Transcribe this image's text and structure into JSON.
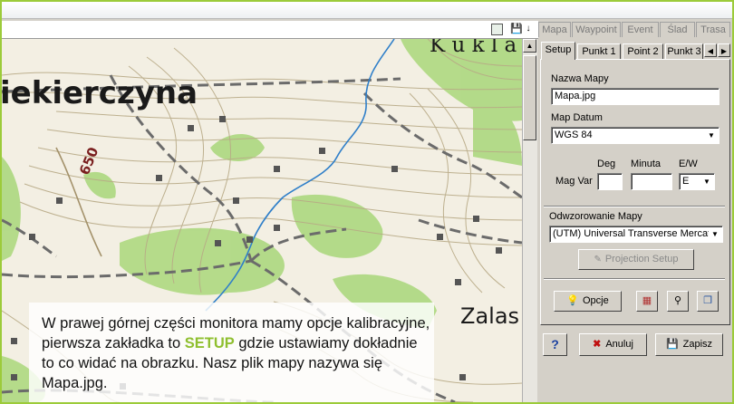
{
  "toolbar": {
    "image_icon": "image-icon",
    "save_icon": "save-download-icon"
  },
  "top_tabs": [
    "Mapa",
    "Waypoint",
    "Event",
    "Ślad",
    "Trasa"
  ],
  "panel_tabs": [
    "Setup",
    "Punkt 1",
    "Point 2",
    "Punkt 3"
  ],
  "setup": {
    "map_name_label": "Nazwa Mapy",
    "map_name_value": "Mapa.jpg",
    "map_datum_label": "Map Datum",
    "map_datum_value": "WGS 84",
    "deg_label": "Deg",
    "minuta_label": "Minuta",
    "ew_label": "E/W",
    "magvar_label": "Mag Var",
    "ew_value": "E",
    "projection_label": "Odwzorowanie Mapy",
    "projection_value": "(UTM) Universal Transverse Mercat",
    "projection_setup_button": "Projection Setup",
    "opcje_button": "Opcje"
  },
  "bottom_buttons": {
    "help": "?",
    "cancel": "Anuluj",
    "save": "Zapisz"
  },
  "map": {
    "place_1": "iekierczyna",
    "place_2": "K u k l a",
    "place_3": "Zalas",
    "elevation": "650",
    "green_accent": "#8fbf2f"
  },
  "note": {
    "line_before": "W prawej górnej części monitora mamy opcje kalibracyjne, pierwsza zakładka to ",
    "highlight": "SETUP",
    "line_after": " gdzie ustawiamy dokładnie to co widać na obrazku. Nasz plik mapy nazywa się Mapa.jpg."
  }
}
